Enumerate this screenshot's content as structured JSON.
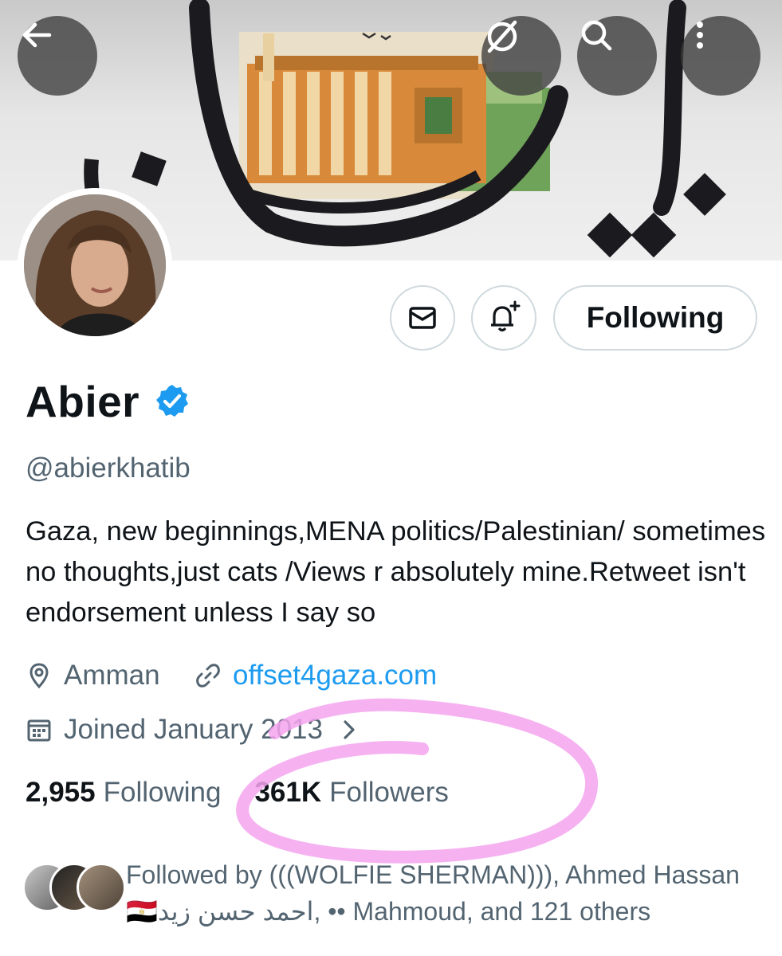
{
  "header": {
    "back_icon": "arrow-left-icon",
    "grok_icon": "grok-icon",
    "search_icon": "search-icon",
    "more_icon": "more-vertical-icon"
  },
  "actions": {
    "message_icon": "envelope-icon",
    "notify_icon": "bell-plus-icon",
    "follow_label": "Following"
  },
  "profile": {
    "name": "Abier",
    "handle": "@abierkhatib",
    "bio": "Gaza, new beginnings,MENA politics/Palestinian/ sometimes no thoughts,just cats /Views r absolutely mine.Retweet isn't endorsement unless I say so",
    "location": "Amman",
    "website": "offset4gaza.com",
    "joined": "Joined January 2013"
  },
  "stats": {
    "following_count": "2,955",
    "following_label": "Following",
    "followers_count": "361K",
    "followers_label": "Followers"
  },
  "followed_by": {
    "line1": "Followed by (((WOLFIE SHERMAN))), Ahmed Hassan",
    "line2": "🇪🇬احمد حسن زيد, •• Mahmoud, and 121 others"
  },
  "colors": {
    "accent": "#1d9bf0",
    "annotation": "#f5a3ef",
    "secondary_text": "#536471"
  }
}
